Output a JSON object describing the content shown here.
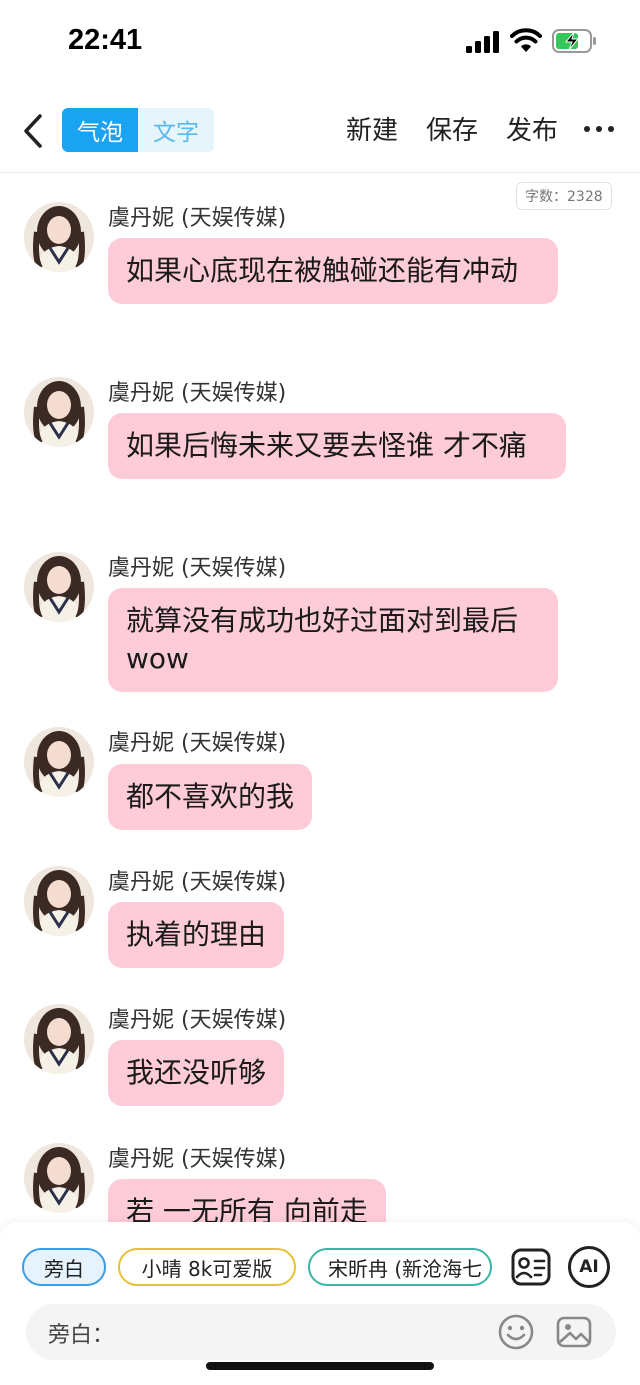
{
  "status_bar": {
    "time": "22:41",
    "signal_icon": "cellular-signal-icon",
    "wifi_icon": "wifi-icon",
    "battery_icon": "battery-charging-icon"
  },
  "toolbar": {
    "back_icon": "chevron-left-icon",
    "mode_tabs": [
      {
        "label": "气泡",
        "active": true
      },
      {
        "label": "文字",
        "active": false
      }
    ],
    "new_label": "新建",
    "save_label": "保存",
    "publish_label": "发布",
    "more_icon": "more-horizontal-icon"
  },
  "word_count": "字数：2328",
  "messages": [
    {
      "name": "虞丹妮 (天娱传媒)",
      "text": "如果心底现在被触碰还能有冲动"
    },
    {
      "name": "虞丹妮 (天娱传媒)",
      "text": "如果后悔未来又要去怪谁 才不痛"
    },
    {
      "name": "虞丹妮 (天娱传媒)",
      "text": "就算没有成功也好过面对到最后 wow"
    },
    {
      "name": "虞丹妮 (天娱传媒)",
      "text": "都不喜欢的我"
    },
    {
      "name": "虞丹妮 (天娱传媒)",
      "text": "执着的理由"
    },
    {
      "name": "虞丹妮 (天娱传媒)",
      "text": "我还没听够"
    },
    {
      "name": "虞丹妮 (天娱传媒)",
      "text": "若 一无所有 向前走"
    }
  ],
  "bottom": {
    "chips": [
      {
        "label": "旁白",
        "selected": true,
        "color": "#3a9ee8"
      },
      {
        "label": "小晴 8k可爱版",
        "selected": false,
        "color": "#e5c235"
      },
      {
        "label": "宋昕冉 (新沧海七",
        "selected": false,
        "color": "#39b5a3"
      }
    ],
    "role_card_icon": "contact-card-icon",
    "ai_label": "AI",
    "input_label": "旁白：",
    "input_value": "",
    "emoji_icon": "emoji-smile-icon",
    "image_icon": "image-icon"
  },
  "colors": {
    "accent": "#1aa3f0",
    "bubble": "#fecbd8"
  }
}
